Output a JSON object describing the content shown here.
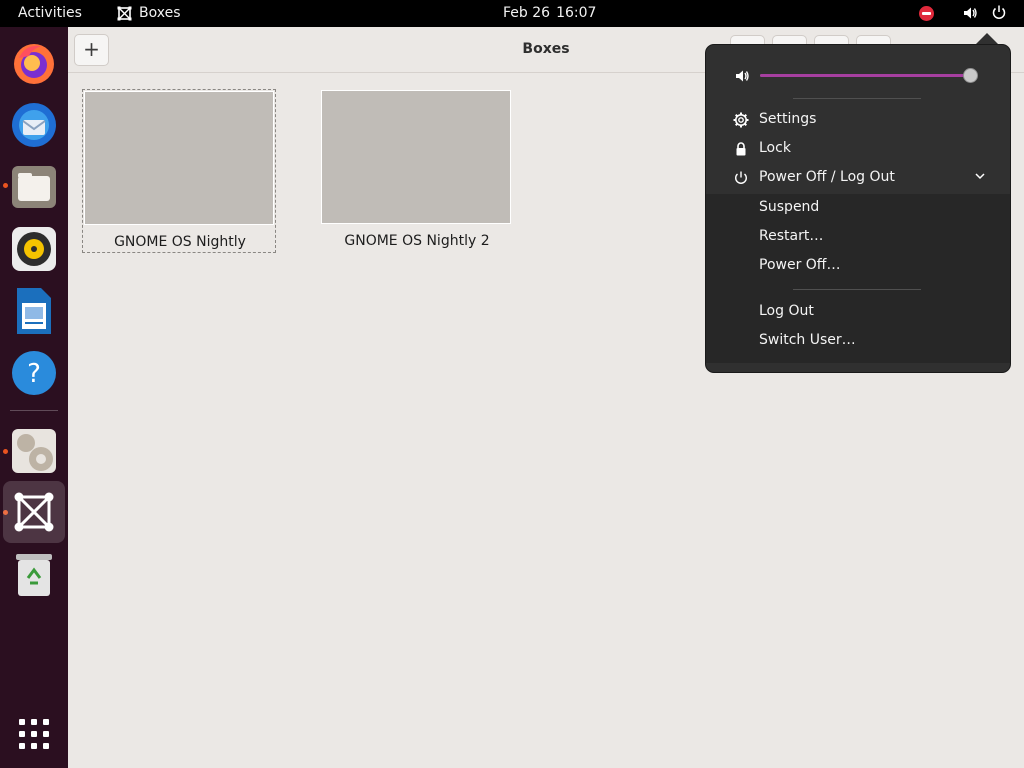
{
  "topbar": {
    "activities": "Activities",
    "app_name": "Boxes",
    "date": "Feb 26",
    "time": "16:07"
  },
  "dock": {
    "items": [
      {
        "name": "firefox-icon",
        "running": false
      },
      {
        "name": "thunderbird-icon",
        "running": false
      },
      {
        "name": "files-icon",
        "running": true
      },
      {
        "name": "rhythmbox-icon",
        "running": false
      },
      {
        "name": "libreoffice-writer-icon",
        "running": false
      },
      {
        "name": "help-icon",
        "running": false
      },
      {
        "name": "software-updater-icon",
        "running": true
      },
      {
        "name": "boxes-icon",
        "running": true,
        "active": true
      },
      {
        "name": "trash-icon",
        "running": false
      }
    ],
    "show_apps_icon": "app-grid-icon"
  },
  "window": {
    "title": "Boxes",
    "new_button": "+",
    "boxes": [
      {
        "label": "GNOME OS Nightly",
        "selected": true
      },
      {
        "label": "GNOME OS Nightly 2",
        "selected": false
      }
    ]
  },
  "system_menu": {
    "volume_percent": 100,
    "volume_icon": "speaker-icon",
    "items": [
      {
        "label": "Settings",
        "icon": "gear-icon"
      },
      {
        "label": "Lock",
        "icon": "lock-icon"
      },
      {
        "label": "Power Off / Log Out",
        "icon": "power-icon",
        "expanded": true
      }
    ],
    "power_submenu": [
      {
        "label": "Suspend"
      },
      {
        "label": "Restart…"
      },
      {
        "label": "Power Off…"
      },
      {
        "label": "Log Out"
      },
      {
        "label": "Switch User…"
      }
    ]
  },
  "colors": {
    "accent": "#e95420",
    "slider": "#a63fa0",
    "dock": "#2b0f20",
    "dnd": "#e0293b"
  }
}
